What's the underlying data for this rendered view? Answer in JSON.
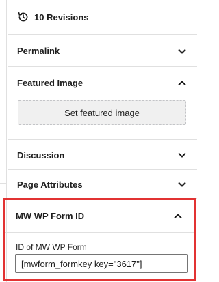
{
  "colors": {
    "highlight": "#e23333",
    "divider": "#e0e0e0",
    "text": "#1e1e1e"
  },
  "revisions": {
    "icon": "history-icon",
    "label": "10 Revisions"
  },
  "sections": {
    "permalink": {
      "title": "Permalink",
      "expanded": false
    },
    "featured_image": {
      "title": "Featured Image",
      "expanded": true,
      "button_label": "Set featured image"
    },
    "discussion": {
      "title": "Discussion",
      "expanded": false
    },
    "page_attributes": {
      "title": "Page Attributes",
      "expanded": false
    },
    "mw_wp_form": {
      "title": "MW WP Form ID",
      "expanded": true,
      "field_label": "ID of MW WP Form",
      "field_value": "[mwform_formkey key=\"3617\"]"
    }
  }
}
